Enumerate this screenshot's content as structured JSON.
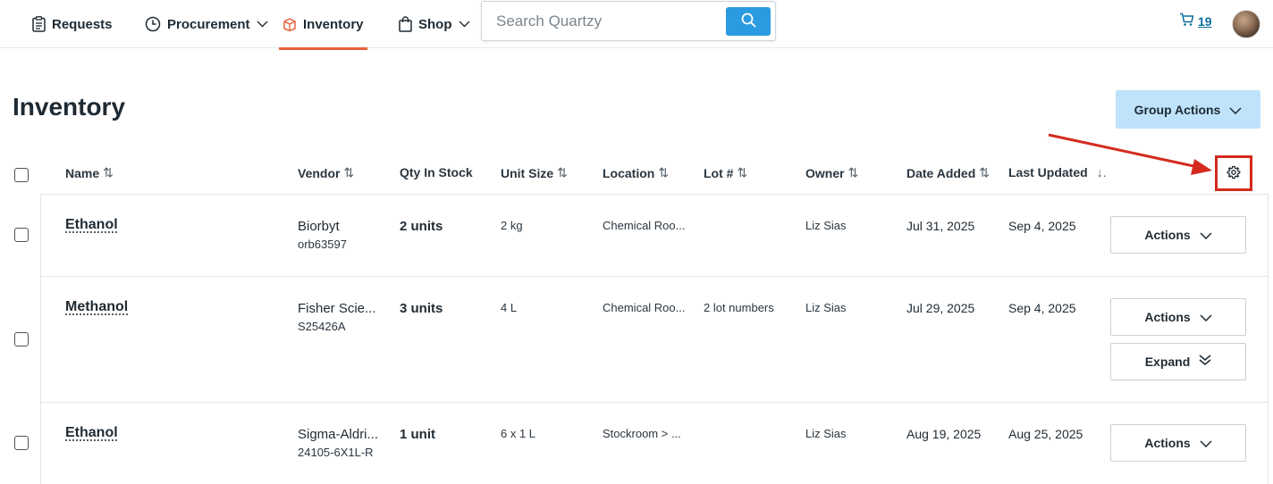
{
  "nav": {
    "requests": "Requests",
    "procurement": "Procurement",
    "inventory": "Inventory",
    "shop": "Shop",
    "search_placeholder": "Search Quartzy",
    "cart_count": "19",
    "accent_color": "#e8603c",
    "link_color": "#0d6e9e",
    "search_button_color": "#2a9be0"
  },
  "page": {
    "title": "Inventory",
    "group_actions_label": "Group Actions"
  },
  "table": {
    "columns": {
      "name": "Name",
      "vendor": "Vendor",
      "qty": "Qty In Stock",
      "unit_size": "Unit Size",
      "location": "Location",
      "lot": "Lot #",
      "owner": "Owner",
      "date_added": "Date Added",
      "last_updated": "Last Updated"
    },
    "rows": [
      {
        "name": "Ethanol",
        "vendor": "Biorbyt",
        "catalog": "orb63597",
        "qty": "2 units",
        "unit_size": "2 kg",
        "location": "Chemical Roo...",
        "lot": "",
        "owner": "Liz Sias",
        "date_added": "Jul 31, 2025",
        "last_updated": "Sep 4, 2025",
        "actions_label": "Actions"
      },
      {
        "name": "Methanol",
        "vendor": "Fisher Scie...",
        "catalog": "S25426A",
        "qty": "3 units",
        "unit_size": "4 L",
        "location": "Chemical Roo...",
        "lot": "2 lot numbers",
        "owner": "Liz Sias",
        "date_added": "Jul 29, 2025",
        "last_updated": "Sep 4, 2025",
        "actions_label": "Actions",
        "expand_label": "Expand"
      },
      {
        "name": "Ethanol",
        "vendor": "Sigma-Aldri...",
        "catalog": "24105-6X1L-R",
        "qty": "1 unit",
        "unit_size": "6 x 1 L",
        "location": "Stockroom > ...",
        "lot": "",
        "owner": "Liz Sias",
        "date_added": "Aug 19, 2025",
        "last_updated": "Aug 25, 2025",
        "actions_label": "Actions"
      }
    ]
  },
  "icons": {
    "requests": "clipboard-icon",
    "procurement": "clock-icon",
    "inventory": "box-icon",
    "shop": "bag-icon",
    "search": "search-icon",
    "cart": "cart-icon",
    "settings": "gear-icon"
  },
  "annotation": {
    "highlight_color": "#d42b1e"
  }
}
